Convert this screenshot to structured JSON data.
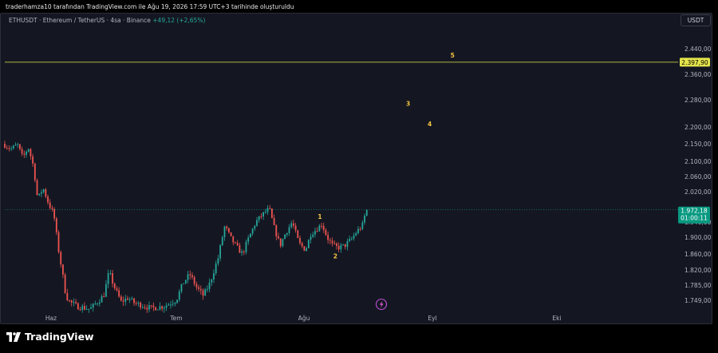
{
  "header": {
    "caption": "traderhamza10 tarafından TradingView.com ile Ağu 19, 2026 17:59 UTC+3 tarihinde oluşturuldu"
  },
  "symbol": {
    "name": "ETHUSDT · Ethereum / TetherUS · 4sa · Binance",
    "change": "+49,12 (+2,65%)"
  },
  "currency": "USDT",
  "footer": {
    "brand": "TradingView"
  },
  "colors": {
    "up": "#26a69a",
    "down": "#ef5350",
    "level_line": "#e5e54c",
    "wave_label": "#f5c542",
    "last_price": "#089981"
  },
  "chart_data": {
    "type": "candlestick",
    "y_range": [
      1725,
      2485
    ],
    "price_ticks": [
      "2.440,00",
      "2.360,00",
      "2.280,00",
      "2.200,00",
      "2.150,00",
      "2.100,00",
      "2.060,00",
      "2.020,00",
      "1.940,00",
      "1.900,00",
      "1.860,00",
      "1.820,00",
      "1.785,00",
      "1.749,00"
    ],
    "price_tick_values": [
      2440,
      2360,
      2280,
      2200,
      2150,
      2100,
      2060,
      2020,
      1940,
      1900,
      1860,
      1820,
      1785,
      1749
    ],
    "time_labels": [
      "Haz",
      "Tem",
      "Ağu",
      "Eyl",
      "Eki"
    ],
    "horizontal_level": {
      "value": 2397.9,
      "label": "2.397,90"
    },
    "last_price": {
      "value": 1972.18,
      "label": "1.972,18",
      "countdown": "01:00:11"
    },
    "wave_labels": [
      {
        "text": "1",
        "price": 1955,
        "time": 0.468
      },
      {
        "text": "2",
        "price": 1855,
        "time": 0.491
      },
      {
        "text": "3",
        "price": 2270,
        "time": 0.599
      },
      {
        "text": "4",
        "price": 2210,
        "time": 0.631
      },
      {
        "text": "5",
        "price": 2420,
        "time": 0.665
      }
    ],
    "price_path": [
      [
        0.0,
        2150
      ],
      [
        0.012,
        2135
      ],
      [
        0.022,
        2148
      ],
      [
        0.03,
        2110
      ],
      [
        0.038,
        2140
      ],
      [
        0.046,
        2085
      ],
      [
        0.052,
        2000
      ],
      [
        0.06,
        2030
      ],
      [
        0.068,
        1990
      ],
      [
        0.076,
        1960
      ],
      [
        0.082,
        1880
      ],
      [
        0.088,
        1820
      ],
      [
        0.094,
        1760
      ],
      [
        0.1,
        1745
      ],
      [
        0.11,
        1735
      ],
      [
        0.13,
        1728
      ],
      [
        0.15,
        1760
      ],
      [
        0.158,
        1815
      ],
      [
        0.166,
        1780
      ],
      [
        0.176,
        1745
      ],
      [
        0.186,
        1755
      ],
      [
        0.196,
        1742
      ],
      [
        0.206,
        1738
      ],
      [
        0.22,
        1730
      ],
      [
        0.24,
        1735
      ],
      [
        0.258,
        1750
      ],
      [
        0.268,
        1790
      ],
      [
        0.278,
        1810
      ],
      [
        0.288,
        1780
      ],
      [
        0.298,
        1760
      ],
      [
        0.308,
        1790
      ],
      [
        0.32,
        1850
      ],
      [
        0.33,
        1930
      ],
      [
        0.338,
        1900
      ],
      [
        0.346,
        1880
      ],
      [
        0.356,
        1860
      ],
      [
        0.366,
        1900
      ],
      [
        0.376,
        1940
      ],
      [
        0.386,
        1960
      ],
      [
        0.396,
        1975
      ],
      [
        0.404,
        1920
      ],
      [
        0.412,
        1880
      ],
      [
        0.42,
        1910
      ],
      [
        0.43,
        1940
      ],
      [
        0.44,
        1885
      ],
      [
        0.45,
        1870
      ],
      [
        0.458,
        1910
      ],
      [
        0.466,
        1920
      ],
      [
        0.474,
        1935
      ],
      [
        0.482,
        1900
      ],
      [
        0.49,
        1880
      ],
      [
        0.498,
        1875
      ],
      [
        0.508,
        1880
      ],
      [
        0.518,
        1895
      ],
      [
        0.526,
        1915
      ],
      [
        0.534,
        1930
      ],
      [
        0.54,
        1972.18
      ]
    ]
  }
}
